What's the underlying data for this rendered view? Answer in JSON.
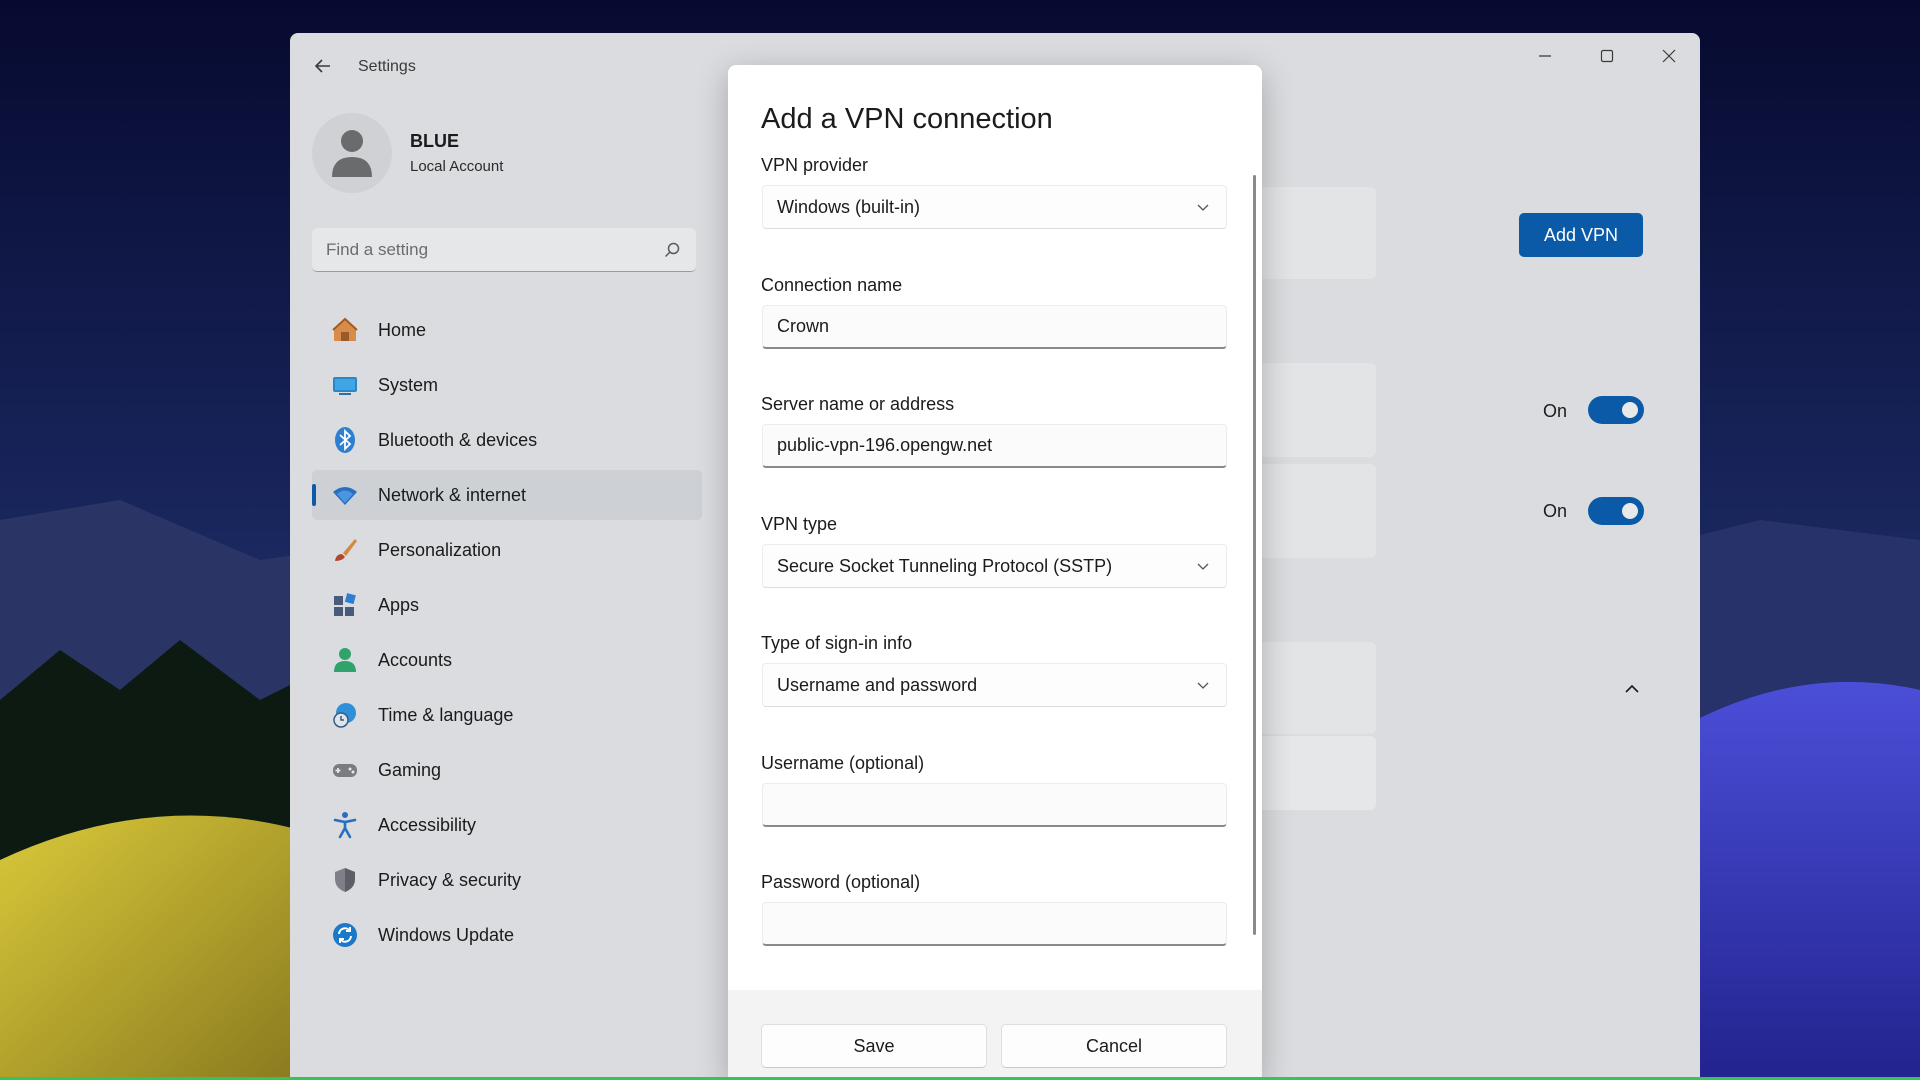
{
  "window": {
    "title": "Settings"
  },
  "profile": {
    "name": "BLUE",
    "account_type": "Local Account"
  },
  "search": {
    "placeholder": "Find a setting"
  },
  "sidebar": {
    "items": [
      {
        "label": "Home",
        "icon": "home-icon"
      },
      {
        "label": "System",
        "icon": "monitor-icon"
      },
      {
        "label": "Bluetooth & devices",
        "icon": "bluetooth-icon"
      },
      {
        "label": "Network & internet",
        "icon": "wifi-icon",
        "active": true
      },
      {
        "label": "Personalization",
        "icon": "brush-icon"
      },
      {
        "label": "Apps",
        "icon": "apps-icon"
      },
      {
        "label": "Accounts",
        "icon": "person-icon"
      },
      {
        "label": "Time & language",
        "icon": "globe-clock-icon"
      },
      {
        "label": "Gaming",
        "icon": "gamepad-icon"
      },
      {
        "label": "Accessibility",
        "icon": "accessibility-icon"
      },
      {
        "label": "Privacy & security",
        "icon": "shield-icon"
      },
      {
        "label": "Windows Update",
        "icon": "update-icon"
      }
    ]
  },
  "content": {
    "add_vpn_label": "Add VPN",
    "toggle_1_label": "On",
    "toggle_2_label": "On"
  },
  "dialog": {
    "title": "Add a VPN connection",
    "vpn_provider": {
      "label": "VPN provider",
      "value": "Windows (built-in)"
    },
    "connection_name": {
      "label": "Connection name",
      "value": "Crown"
    },
    "server": {
      "label": "Server name or address",
      "value": "public-vpn-196.opengw.net"
    },
    "vpn_type": {
      "label": "VPN type",
      "value": "Secure Socket Tunneling Protocol (SSTP)"
    },
    "signin_type": {
      "label": "Type of sign-in info",
      "value": "Username and password"
    },
    "username": {
      "label": "Username (optional)",
      "value": ""
    },
    "password": {
      "label": "Password (optional)",
      "value": ""
    },
    "save_label": "Save",
    "cancel_label": "Cancel"
  },
  "colors": {
    "accent": "#0b5aa8",
    "window_bg": "#dadcdf",
    "dialog_bg": "#ffffff"
  }
}
